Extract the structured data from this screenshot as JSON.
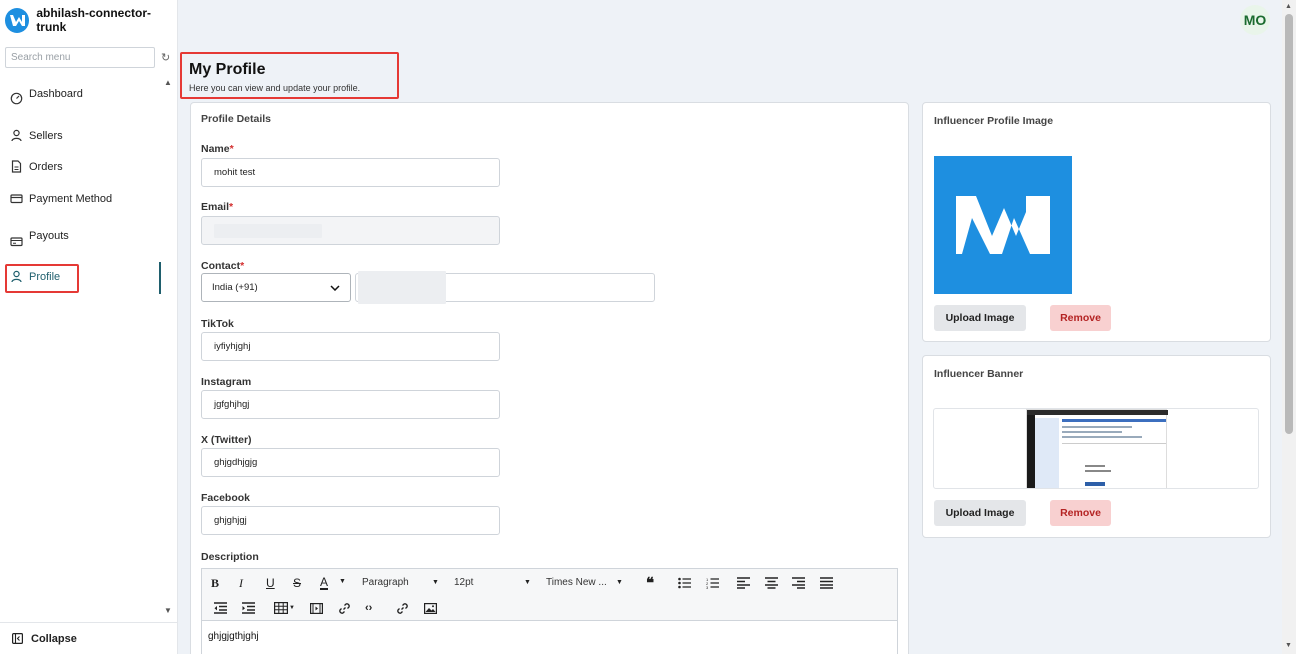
{
  "app": {
    "name": "abhilash-connector-trunk"
  },
  "sidebar": {
    "search_placeholder": "Search menu",
    "items": [
      {
        "label": "Dashboard",
        "icon": "gauge-icon"
      },
      {
        "label": "Sellers",
        "icon": "user-icon"
      },
      {
        "label": "Orders",
        "icon": "document-icon"
      },
      {
        "label": "Payment Method",
        "icon": "card-icon"
      },
      {
        "label": "Payouts",
        "icon": "wallet-icon"
      },
      {
        "label": "Profile",
        "icon": "user-icon",
        "active": true
      }
    ],
    "collapse_label": "Collapse"
  },
  "header": {
    "avatar_initials": "MO"
  },
  "page": {
    "title": "My Profile",
    "subtitle": "Here you can view and update your profile."
  },
  "profile_details": {
    "title": "Profile Details",
    "name_label": "Name",
    "name_value": "mohit test",
    "email_label": "Email",
    "contact_label": "Contact",
    "country_value": "India (+91)",
    "tiktok_label": "TikTok",
    "tiktok_value": "iyfiyhjghj",
    "instagram_label": "Instagram",
    "instagram_value": "jgfghjhgj",
    "twitter_label": "X (Twitter)",
    "twitter_value": "ghjgdhjgjg",
    "facebook_label": "Facebook",
    "facebook_value": "ghjghjgj",
    "description_label": "Description",
    "required_marker": "*",
    "editor": {
      "block_format": "Paragraph",
      "font_size": "12pt",
      "font_family": "Times New ...",
      "content": "ghjgjgthjghj"
    }
  },
  "profile_image": {
    "title": "Influencer Profile Image",
    "upload_label": "Upload Image",
    "remove_label": "Remove"
  },
  "banner": {
    "title": "Influencer Banner",
    "upload_label": "Upload Image",
    "remove_label": "Remove"
  },
  "colors": {
    "accent": "#1f5f6d",
    "brand": "#1e8fe0",
    "highlight": "#e53935",
    "remove_bg": "#f8d0d0"
  }
}
